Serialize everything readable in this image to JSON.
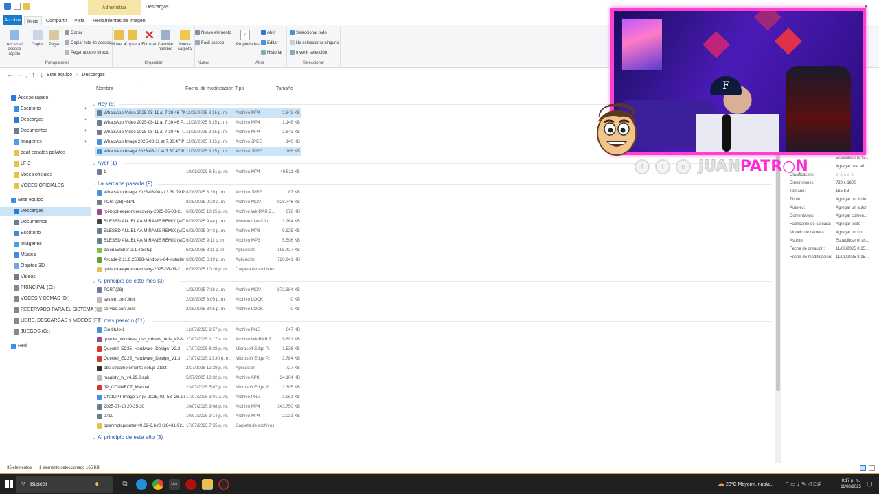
{
  "window": {
    "context_tab": "Administrar",
    "title": "Descargas",
    "close_glyph": "×"
  },
  "ribbon_tabs": [
    "Archivo",
    "Inicio",
    "Compartir",
    "Vista",
    "Herramientas de imagen"
  ],
  "ribbon": {
    "portapapeles": {
      "label": "Portapapeles",
      "anclar": "Anclar al acceso rápido",
      "copiar": "Copiar",
      "pegar": "Pegar",
      "cortar": "Cortar",
      "copiar_ruta": "Copiar ruta de acceso",
      "pegar_acceso": "Pegar acceso directo"
    },
    "organizar": {
      "label": "Organizar",
      "mover": "Mover a",
      "copiar_a": "Copiar a",
      "eliminar": "Eliminar",
      "cambiar": "Cambiar nombre"
    },
    "nuevo": {
      "label": "Nuevo",
      "carpeta": "Nueva carpeta",
      "elemento": "Nuevo elemento",
      "facil": "Fácil acceso"
    },
    "abrir": {
      "label": "Abrir",
      "propiedades": "Propiedades",
      "abrir": "Abrir",
      "editar": "Editar",
      "historial": "Historial"
    },
    "seleccionar": {
      "label": "Seleccionar",
      "todo": "Seleccionar todo",
      "ninguno": "No seleccionar ninguno",
      "invertir": "Invertir selección"
    }
  },
  "breadcrumbs": [
    "Este equipo",
    "Descargas"
  ],
  "sidebar": [
    {
      "label": "Acceso rápido",
      "color": "#2d7bd6",
      "indent": 0
    },
    {
      "label": "Escritorio",
      "color": "#3a8ee6",
      "indent": 1,
      "pin": true
    },
    {
      "label": "Descargas",
      "color": "#2d7bd6",
      "indent": 1,
      "pin": true
    },
    {
      "label": "Documentos",
      "color": "#6b7c93",
      "indent": 1,
      "pin": true
    },
    {
      "label": "Imágenes",
      "color": "#4aa0e0",
      "indent": 1,
      "pin": true
    },
    {
      "label": "beat canales polvitos",
      "color": "#e8c04a",
      "indent": 1
    },
    {
      "label": "LF 3",
      "color": "#e8c04a",
      "indent": 1
    },
    {
      "label": "Voces oficiales",
      "color": "#e8c04a",
      "indent": 1
    },
    {
      "label": "VOCES OFICIALES",
      "color": "#e8c04a",
      "indent": 1
    },
    {
      "label": "",
      "color": "",
      "indent": 0,
      "spacer": true
    },
    {
      "label": "Este equipo",
      "color": "#3a8ee6",
      "indent": 0
    },
    {
      "label": "Descargas",
      "color": "#2d7bd6",
      "indent": 1,
      "selected": true
    },
    {
      "label": "Documentos",
      "color": "#6b7c93",
      "indent": 1
    },
    {
      "label": "Escritorio",
      "color": "#3a8ee6",
      "indent": 1
    },
    {
      "label": "Imágenes",
      "color": "#4aa0e0",
      "indent": 1
    },
    {
      "label": "Música",
      "color": "#3a8ee6",
      "indent": 1
    },
    {
      "label": "Objetos 3D",
      "color": "#6fa8dc",
      "indent": 1
    },
    {
      "label": "Vídeos",
      "color": "#6b7c93",
      "indent": 1
    },
    {
      "label": "PRINCIPAL (C:)",
      "color": "#888888",
      "indent": 1
    },
    {
      "label": "VOCES Y DEMAS (D:)",
      "color": "#888888",
      "indent": 1
    },
    {
      "label": "RESERVADO PARA EL SISTEMA (E:)",
      "color": "#888888",
      "indent": 1
    },
    {
      "label": "LIBRE, DESCARGAS Y VIDEOS (F:)",
      "color": "#888888",
      "indent": 1
    },
    {
      "label": "JUEGOS (G:)",
      "color": "#888888",
      "indent": 1
    },
    {
      "label": "",
      "color": "",
      "indent": 0,
      "spacer": true
    },
    {
      "label": "Red",
      "color": "#3a8ee6",
      "indent": 0
    }
  ],
  "columns": {
    "name": "Nombre",
    "date": "Fecha de modificación",
    "type": "Tipo",
    "size": "Tamaño"
  },
  "groups": [
    {
      "title": "Hoy (5)",
      "files": [
        {
          "name": "WhatsApp Video 2025-08-11 at 7.30.46 PM",
          "date": "11/08/2025 8:15 p. m.",
          "type": "Archivo MP4",
          "size": "2.643 KB",
          "color": "#6b7c93",
          "selected": true
        },
        {
          "name": "WhatsApp Video 2025-08-11 at 7.30.46 P...",
          "date": "11/08/2025 8:15 p. m.",
          "type": "Archivo MP4",
          "size": "1.146 KB",
          "color": "#6b7c93"
        },
        {
          "name": "WhatsApp Video 2025-08-11 at 7.30.46 P...",
          "date": "11/08/2025 8:15 p. m.",
          "type": "Archivo MP4",
          "size": "2.643 KB",
          "color": "#6b7c93"
        },
        {
          "name": "WhatsApp Image 2025-08-11 at 7.30.47 PM",
          "date": "11/08/2025 8:15 p. m.",
          "type": "Archivo JPEG",
          "size": "140 KB",
          "color": "#4a90d9"
        },
        {
          "name": "WhatsApp Image 2025-08-11 at 7.30.47 P...",
          "date": "11/08/2025 8:15 p. m.",
          "type": "Archivo JPEG",
          "size": "166 KB",
          "color": "#4a90d9",
          "selected": true
        }
      ]
    },
    {
      "title": "Ayer (1)",
      "files": [
        {
          "name": "1",
          "date": "10/08/2025 6:51 p. m.",
          "type": "Archivo MP4",
          "size": "49.511 KB",
          "color": "#6b7c93"
        }
      ]
    },
    {
      "title": "La semana pasada (9)",
      "files": [
        {
          "name": "WhatsApp Image 2025-08-08 at 3.39.09 PM",
          "date": "8/08/2025 3:39 p. m.",
          "type": "Archivo JPEG",
          "size": "87 KB",
          "color": "#4a90d9"
        },
        {
          "name": "TCRP(28)FINAL",
          "date": "8/08/2025 9:29 a. m.",
          "type": "Archivo MOV",
          "size": "928.746 KB",
          "color": "#6b7c93"
        },
        {
          "name": "rpi-boot-eeprom-recovery-2025-05-08-2...",
          "date": "6/08/2025 10:25 p. m.",
          "type": "Archivo WinRAR Z...",
          "size": "878 KB",
          "color": "#9b4a8c"
        },
        {
          "name": "BLESSD  ANUEL AA  MIRAME REMIX (VID...",
          "date": "6/08/2025 9:44 p. m.",
          "type": "Ableton Live Clip ...",
          "size": "1.264 KB",
          "color": "#444444"
        },
        {
          "name": "BLESSD  ANUEL AA  MIRAME REMIX (VID...",
          "date": "6/08/2025 9:43 p. m.",
          "type": "Archivo MP3",
          "size": "9.325 KB",
          "color": "#6b7c93"
        },
        {
          "name": "BLESSD  ANUEL AA  MIRAME REMIX (VID...",
          "date": "6/08/2025 9:11 p. m.",
          "type": "Archivo MP3",
          "size": "5.596 KB",
          "color": "#6b7c93"
        },
        {
          "name": "balenaEtcher-2.1.4.Setup",
          "date": "6/08/2025 8:11 p. m.",
          "type": "Aplicación",
          "size": "195.427 KB",
          "color": "#7cc242"
        },
        {
          "name": "Arcade-2.11.0.25098-windows-64-installer",
          "date": "6/08/2025 5:19 p. m.",
          "type": "Aplicación",
          "size": "720.941 KB",
          "color": "#6a9a3a"
        },
        {
          "name": "rpi-boot-eeprom-recovery-2025-05-08-2...",
          "date": "6/08/2025 10:26 p. m.",
          "type": "Carpeta de archivos",
          "size": "",
          "color": "#e8c04a"
        }
      ]
    },
    {
      "title": "Al principio de este mes (3)",
      "files": [
        {
          "name": "TCRP(28)",
          "date": "1/08/2025 7:16 a. m.",
          "type": "Archivo MOV",
          "size": "872.384 KB",
          "color": "#6b7c93"
        },
        {
          "name": "system.conf.lock",
          "date": "2/08/2025 3:05 p. m.",
          "type": "Archivo LOCK",
          "size": "0 KB",
          "color": "#bbbbbb"
        },
        {
          "name": "service.conf.lock",
          "date": "2/08/2025 3:05 p. m.",
          "type": "Archivo LOCK",
          "size": "0 KB",
          "color": "#bbbbbb"
        }
      ]
    },
    {
      "title": "El mes pasado (11)",
      "files": [
        {
          "name": "Sin-título-1",
          "date": "12/07/2025 8:57 p. m.",
          "type": "Archivo PNG",
          "size": "647 KB",
          "color": "#4a90d9"
        },
        {
          "name": "quectel_windows_usb_drivers_ndis_v2-8-...",
          "date": "27/07/2025 1:17 a. m.",
          "type": "Archivo WinRAR Z...",
          "size": "9.691 KB",
          "color": "#9b4a8c"
        },
        {
          "name": "Quectel_EC25_Hardware_Design_V2.2",
          "date": "17/07/2025 8:38 p. m.",
          "type": "Microsoft Edge P...",
          "size": "1.536 KB",
          "color": "#d33a2c"
        },
        {
          "name": "Quectel_EC25_Hardware_Design_V1.3",
          "date": "17/07/2025 10:30 p. m.",
          "type": "Microsoft Edge P...",
          "size": "3.784 KB",
          "color": "#d33a2c"
        },
        {
          "name": "obs-streamelements-setup-latest",
          "date": "2/07/2025 12:28 p. m.",
          "type": "Aplicación",
          "size": "727 KB",
          "color": "#333333"
        },
        {
          "name": "magistv_tv_v4.29.2.apk",
          "date": "5/07/2025 10:32 p. m.",
          "type": "Archivo APK",
          "size": "34.104 KB",
          "color": "#bbbbbb"
        },
        {
          "name": "JP_CONNECT_Manual",
          "date": "23/07/2025 5:07 p. m.",
          "type": "Microsoft Edge P...",
          "size": "1.305 KB",
          "color": "#d33a2c"
        },
        {
          "name": "ChatGPT Image 17 jul 2025, 02_58_26 a.m.",
          "date": "17/07/2025 3:01 a. m.",
          "type": "Archivo PNG",
          "size": "1.951 KB",
          "color": "#4a90d9"
        },
        {
          "name": "2025-07-10 20-35-30",
          "date": "10/07/2025 9:08 p. m.",
          "type": "Archivo MP4",
          "size": "343.750 KB",
          "color": "#6b7c93"
        },
        {
          "name": "0710",
          "date": "10/07/2025 9:14 p. m.",
          "type": "Archivo MP4",
          "size": "2.031 KB",
          "color": "#6b7c93"
        },
        {
          "name": "openmptcprouter-v0.62-6.6-r0+28431-92...",
          "date": "17/07/2025 7:55 p. m.",
          "type": "Carpeta de archivos",
          "size": "",
          "color": "#e8c04a"
        }
      ]
    },
    {
      "title": "Al principio de este año (3)",
      "files": []
    }
  ],
  "details": [
    {
      "k": "",
      "v": "Especificar la fe..."
    },
    {
      "k": "",
      "v": "Agregar una eti..."
    },
    {
      "k": "Clasificación:",
      "v": "☆☆☆☆☆"
    },
    {
      "k": "Dimensiones:",
      "v": "739 x 1600"
    },
    {
      "k": "Tamaño:",
      "v": "165 KB"
    },
    {
      "k": "Título:",
      "v": "Agregar un título"
    },
    {
      "k": "Autores:",
      "v": "Agregar un autor"
    },
    {
      "k": "Comentarios:",
      "v": "Agregar comen..."
    },
    {
      "k": "Fabricante de cámara:",
      "v": "Agregar texto"
    },
    {
      "k": "Modelo de cámara:",
      "v": "Agregar un no..."
    },
    {
      "k": "Asunto:",
      "v": "Especificar el as..."
    },
    {
      "k": "Fecha de creación:",
      "v": "11/08/2025 8:15..."
    },
    {
      "k": "Fecha de modificación:",
      "v": "11/08/2025 8:15..."
    }
  ],
  "status": {
    "count": "35 elementos",
    "selected": "1 elemento seleccionado  165 KB"
  },
  "overlay": {
    "cap_letter": "F",
    "brand_a": "JUAN",
    "brand_b": "PATR○N",
    "social_icons": [
      "f",
      "t",
      "o"
    ]
  },
  "taskbar": {
    "search": "Buscar",
    "weather": "20°C  Mayorm. nubla...",
    "lang": "ESP",
    "time": "8:17 p. m.",
    "date": "11/08/2025"
  }
}
